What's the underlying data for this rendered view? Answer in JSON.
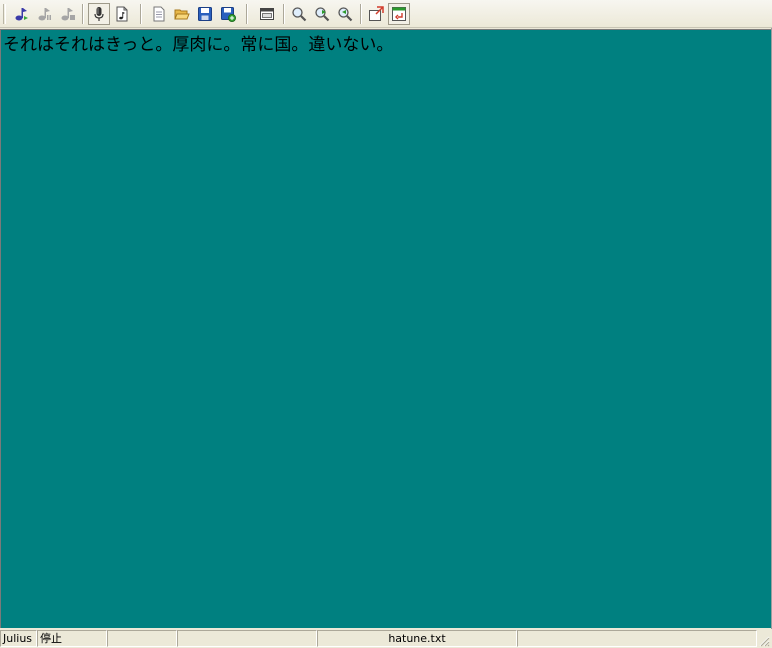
{
  "toolbar": {
    "buttons": [
      {
        "name": "recognize-start-icon"
      },
      {
        "name": "recognize-pause-icon"
      },
      {
        "name": "recognize-stop-icon"
      },
      {
        "name": "microphone-icon"
      },
      {
        "name": "audio-file-icon"
      },
      {
        "name": "new-file-icon"
      },
      {
        "name": "open-folder-icon"
      },
      {
        "name": "save-icon"
      },
      {
        "name": "save-as-icon"
      },
      {
        "name": "window-settings-icon"
      },
      {
        "name": "zoom-icon"
      },
      {
        "name": "zoom-in-icon"
      },
      {
        "name": "zoom-out-icon"
      },
      {
        "name": "export-icon"
      },
      {
        "name": "dock-window-icon"
      }
    ]
  },
  "editor": {
    "background": "#008080",
    "text": "それはそれはきっと。厚肉に。常に国。違いない。"
  },
  "status": {
    "engine": "Julius",
    "state": "停止",
    "pane3": "",
    "pane4": "",
    "pane5": "",
    "filename": "hatune.txt",
    "pane7": ""
  }
}
